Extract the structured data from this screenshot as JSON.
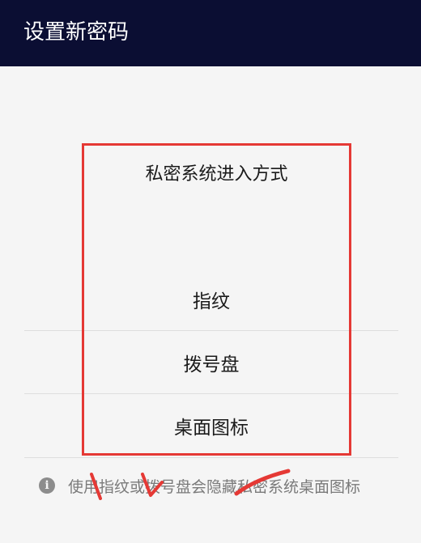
{
  "header": {
    "title": "设置新密码"
  },
  "dialog": {
    "title": "私密系统进入方式",
    "options": [
      {
        "label": "指纹"
      },
      {
        "label": "拨号盘"
      },
      {
        "label": "桌面图标"
      }
    ]
  },
  "hint": {
    "icon": "info-icon",
    "text": "使用指纹或拨号盘会隐藏私密系统桌面图标"
  },
  "colors": {
    "header_bg": "#0b0e33",
    "background": "#f5f5f5",
    "highlight": "#e53935"
  }
}
